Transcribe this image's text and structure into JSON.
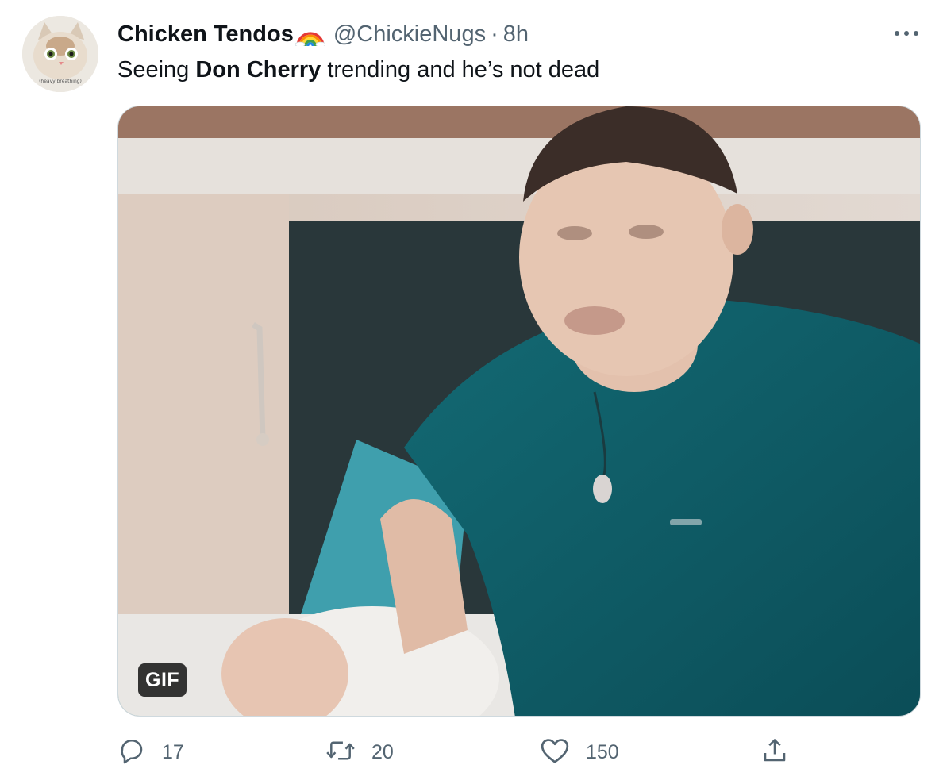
{
  "tweet": {
    "author": {
      "display_name": "Chicken Tendos",
      "name_emoji": "rainbow-icon",
      "handle": "@ChickieNugs",
      "separator": "·",
      "time": "8h",
      "avatar_caption": "(heavy breathing)"
    },
    "text_before": "Seeing ",
    "text_bold": "Don Cherry",
    "text_after": " trending and he’s not dead",
    "media": {
      "type": "gif",
      "badge": "GIF"
    },
    "actions": {
      "replies": "17",
      "retweets": "20",
      "likes": "150"
    }
  },
  "icons": [
    "more-icon",
    "reply-icon",
    "retweet-icon",
    "like-icon",
    "share-icon"
  ],
  "colors": {
    "text": "#0f1419",
    "muted": "#536471",
    "border": "#cfd9de"
  }
}
